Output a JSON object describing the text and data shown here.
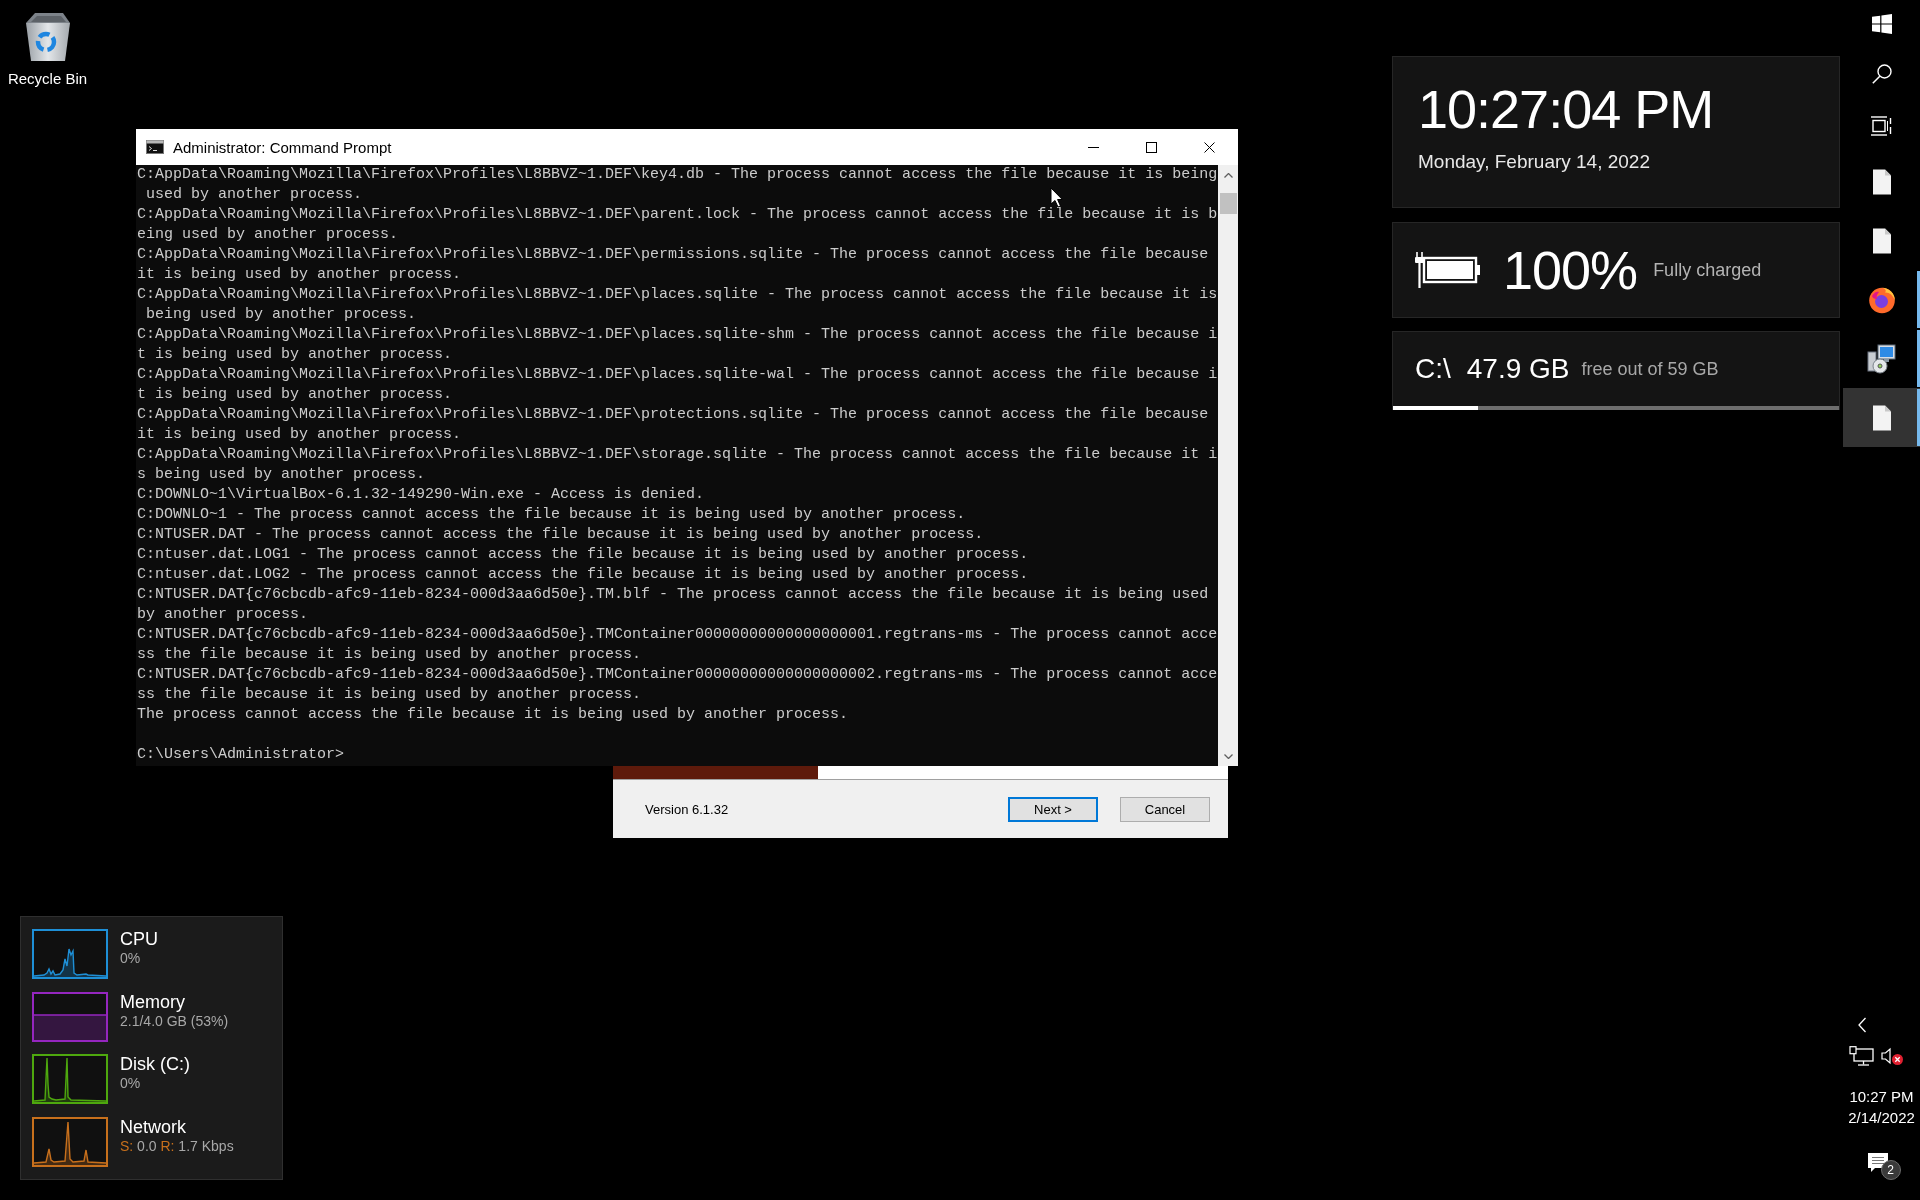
{
  "desktop_icons": [
    {
      "label": "Recycle Bin"
    }
  ],
  "console": {
    "title": "Administrator: Command Prompt",
    "rows": [
      "C:AppData\\Roaming\\Mozilla\\Firefox\\Profiles\\L8BBVZ~1.DEF\\key4.db - The process cannot access the file because it is being",
      " used by another process.",
      "C:AppData\\Roaming\\Mozilla\\Firefox\\Profiles\\L8BBVZ~1.DEF\\parent.lock - The process cannot access the file because it is b",
      "eing used by another process.",
      "C:AppData\\Roaming\\Mozilla\\Firefox\\Profiles\\L8BBVZ~1.DEF\\permissions.sqlite - The process cannot access the file because",
      "it is being used by another process.",
      "C:AppData\\Roaming\\Mozilla\\Firefox\\Profiles\\L8BBVZ~1.DEF\\places.sqlite - The process cannot access the file because it is",
      " being used by another process.",
      "C:AppData\\Roaming\\Mozilla\\Firefox\\Profiles\\L8BBVZ~1.DEF\\places.sqlite-shm - The process cannot access the file because i",
      "t is being used by another process.",
      "C:AppData\\Roaming\\Mozilla\\Firefox\\Profiles\\L8BBVZ~1.DEF\\places.sqlite-wal - The process cannot access the file because i",
      "t is being used by another process.",
      "C:AppData\\Roaming\\Mozilla\\Firefox\\Profiles\\L8BBVZ~1.DEF\\protections.sqlite - The process cannot access the file because",
      "it is being used by another process.",
      "C:AppData\\Roaming\\Mozilla\\Firefox\\Profiles\\L8BBVZ~1.DEF\\storage.sqlite - The process cannot access the file because it i",
      "s being used by another process.",
      "C:DOWNLO~1\\VirtualBox-6.1.32-149290-Win.exe - Access is denied.",
      "C:DOWNLO~1 - The process cannot access the file because it is being used by another process.",
      "C:NTUSER.DAT - The process cannot access the file because it is being used by another process.",
      "C:ntuser.dat.LOG1 - The process cannot access the file because it is being used by another process.",
      "C:ntuser.dat.LOG2 - The process cannot access the file because it is being used by another process.",
      "C:NTUSER.DAT{c76cbcdb-afc9-11eb-8234-000d3aa6d50e}.TM.blf - The process cannot access the file because it is being used",
      "by another process.",
      "C:NTUSER.DAT{c76cbcdb-afc9-11eb-8234-000d3aa6d50e}.TMContainer00000000000000000001.regtrans-ms - The process cannot acce",
      "ss the file because it is being used by another process.",
      "C:NTUSER.DAT{c76cbcdb-afc9-11eb-8234-000d3aa6d50e}.TMContainer00000000000000000002.regtrans-ms - The process cannot acce",
      "ss the file because it is being used by another process.",
      "The process cannot access the file because it is being used by another process."
    ],
    "prompt": "C:\\Users\\Administrator>"
  },
  "installer": {
    "version": "Version 6.1.32",
    "buttons": [
      {
        "label": "Next >",
        "default": true
      },
      {
        "label": "Cancel",
        "default": false
      }
    ]
  },
  "clock": {
    "time": "10:27:04 PM",
    "date": "Monday, February 14, 2022"
  },
  "battery": {
    "percent": "100%",
    "status": "Fully charged"
  },
  "disk": {
    "drive": "C:\\",
    "free": "47.9 GB",
    "detail": "free out of 59 GB",
    "level": 0.19
  },
  "performance": [
    {
      "kind": "cpu",
      "name": "CPU",
      "reading": "0%",
      "color": "#1e8fd6"
    },
    {
      "kind": "memory",
      "name": "Memory",
      "reading": "2.1/4.0 GB (53%)",
      "color": "#9526bf"
    },
    {
      "kind": "disk",
      "name": "Disk (C:)",
      "reading": "0%",
      "color": "#4ea80e"
    },
    {
      "kind": "network",
      "name": "Network",
      "sent_label": "S:",
      "sent": "0.0",
      "received_label": "R:",
      "received": "1.7 Kbps",
      "color": "#c8701c"
    }
  ],
  "taskbar": {
    "items": [
      {
        "kind": "start",
        "running": false,
        "selected": false
      },
      {
        "kind": "search",
        "running": false,
        "selected": false
      },
      {
        "kind": "task_view",
        "running": false,
        "selected": false
      },
      {
        "kind": "document",
        "running": false,
        "selected": false
      },
      {
        "kind": "document",
        "running": false,
        "selected": false
      },
      {
        "kind": "browser",
        "running": true,
        "selected": false
      },
      {
        "kind": "installer",
        "running": true,
        "selected": false
      },
      {
        "kind": "document",
        "running": true,
        "selected": true
      }
    ],
    "tray": {
      "muted": true,
      "time": "10:27 PM",
      "date": "2/14/2022",
      "notification_count": "2"
    }
  }
}
